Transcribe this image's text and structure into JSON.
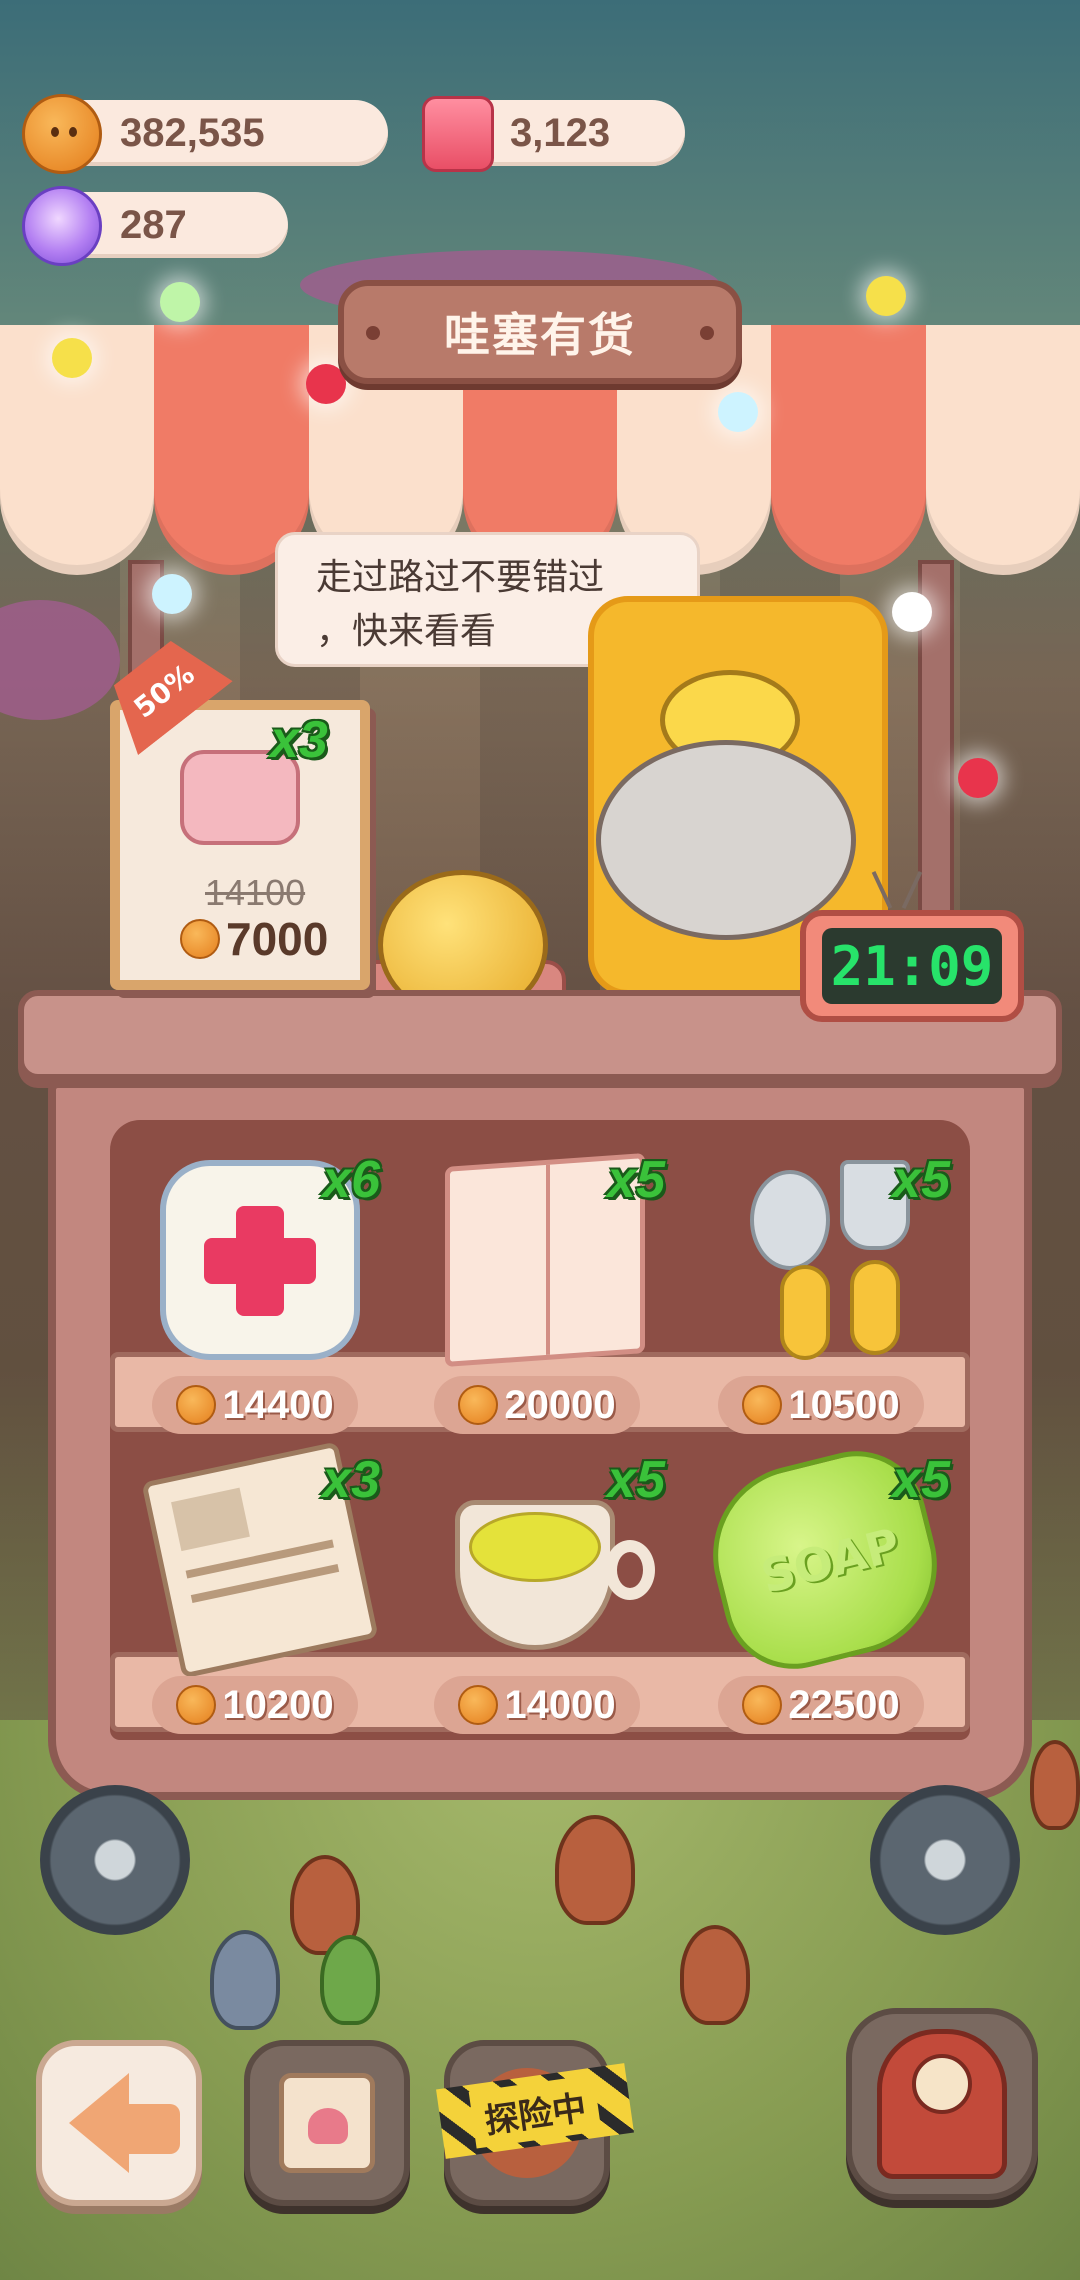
{
  "currency": {
    "cookies": "382,535",
    "candles": "3,123",
    "candy": "287"
  },
  "shop": {
    "title": "哇塞有货",
    "speech": "走过路过不要错过，快来看看",
    "speech_line1": "走过路过不要错过",
    "speech_line2": "，快来看看",
    "timer": "21:09"
  },
  "special_offer": {
    "discount": "50%",
    "item": "pillow",
    "quantity": "x3",
    "old_price": "14100",
    "price": "7000"
  },
  "items": [
    {
      "name": "first-aid-kit",
      "quantity": "x6",
      "price": "14400"
    },
    {
      "name": "magazine",
      "quantity": "x5",
      "price": "20000"
    },
    {
      "name": "spoon-and-fork",
      "quantity": "x5",
      "price": "10500"
    },
    {
      "name": "newspaper",
      "quantity": "x3",
      "price": "10200"
    },
    {
      "name": "tea-cup",
      "quantity": "x5",
      "price": "14000"
    },
    {
      "name": "soap",
      "quantity": "x5",
      "price": "22500"
    }
  ],
  "soap_text": "SOAP",
  "exploring_label": "探险中",
  "colors": {
    "awning_red": "#f07b66",
    "awning_cream": "#fbe0cc",
    "quantity_green": "#3ac23a",
    "timer_green": "#27e36a"
  }
}
